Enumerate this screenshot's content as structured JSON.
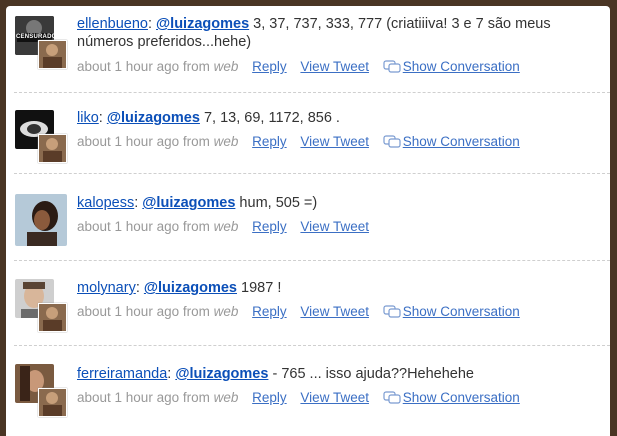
{
  "tweets": [
    {
      "user": "ellenbueno",
      "mention": "@luizagomes",
      "text": " 3, 37, 737, 333, 777 (criatiiiva! 3 e 7 são meus números preferidos...hehe)",
      "time": "about 1 hour ago from",
      "source": "web",
      "reply": "Reply",
      "view": "View Tweet",
      "conversation": "Show Conversation",
      "avatar_label": "CENSURADO"
    },
    {
      "user": "liko",
      "mention": "@luizagomes",
      "text": " 7, 13, 69, 1172, 856 .",
      "time": "about 1 hour ago from",
      "source": "web",
      "reply": "Reply",
      "view": "View Tweet",
      "conversation": "Show Conversation"
    },
    {
      "user": "kalopess",
      "mention": "@luizagomes",
      "text": " hum, 505 =)",
      "time": "about 1 hour ago from",
      "source": "web",
      "reply": "Reply",
      "view": "View Tweet"
    },
    {
      "user": "molynary",
      "mention": "@luizagomes",
      "text": " 1987 !",
      "time": "about 1 hour ago from",
      "source": "web",
      "reply": "Reply",
      "view": "View Tweet",
      "conversation": "Show Conversation"
    },
    {
      "user": "ferreiramanda",
      "mention": "@luizagomes",
      "text": " - 765 ... isso ajuda??Hehehehe",
      "time": "about 1 hour ago from",
      "source": "web",
      "reply": "Reply",
      "view": "View Tweet",
      "conversation": "Show Conversation"
    }
  ],
  "colors": {
    "link": "#0b4fb8",
    "meta": "#999999",
    "frame": "#4a3524"
  }
}
